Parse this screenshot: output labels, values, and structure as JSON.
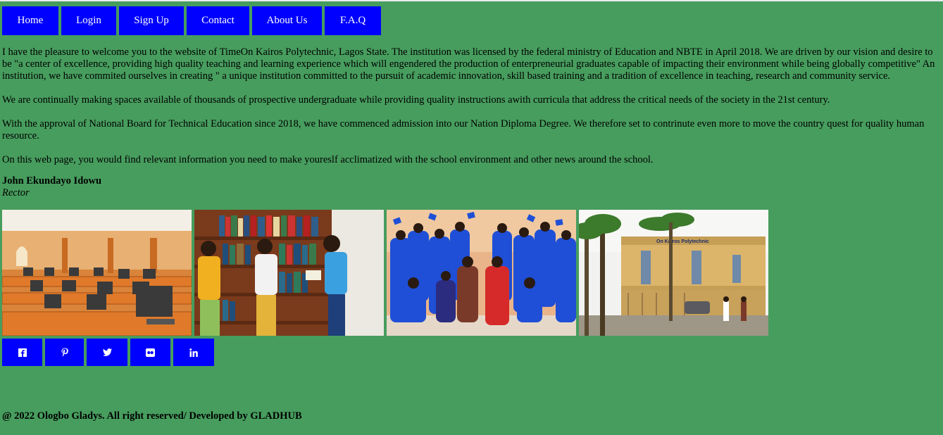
{
  "nav": {
    "items": [
      {
        "label": "Home"
      },
      {
        "label": "Login"
      },
      {
        "label": "Sign Up"
      },
      {
        "label": "Contact"
      },
      {
        "label": "About Us"
      },
      {
        "label": "F.A.Q"
      }
    ]
  },
  "content": {
    "paragraphs": [
      "I have the pleasure to welcome you to the website of TimeOn Kairos Polytechnic, Lagos State. The institution was licensed by the federal ministry of Education and NBTE in April 2018. We are driven by our vision and desire to be \"a center of excellence, providing high quality teaching and learning experience which will engendered the production of enterpreneurial graduates capable of impacting their environment while being globally competitive\" An institution, we have commited ourselves in creating \" a unique institution committed to the pursuit of academic innovation, skill based training and a tradition of excellence in teaching, research and community service.",
      "We are continually making spaces available of thousands of prospective undergraduate while providing quality instructions awith curricula that address the critical needs of the society in the 21st century.",
      "With the approval of National Board for Technical Education since 2018, we have commenced admission into our Nation Diploma Degree. We therefore set to contrinute even more to move the country quest for quality human resource.",
      "On this web page, you would find relevant information you need to make youreslf acclimatized with the school environment and other news around the school."
    ],
    "signature_name": "John Ekundayo Idowu",
    "signature_role": "Rector"
  },
  "gallery": {
    "photos": [
      {
        "name": "computer-lab-photo"
      },
      {
        "name": "library-photo"
      },
      {
        "name": "graduation-photo"
      },
      {
        "name": "campus-building-photo"
      }
    ],
    "building_sign": "On Kairos Polytechnic"
  },
  "social": {
    "icons": [
      "facebook-icon",
      "pinterest-icon",
      "twitter-icon",
      "flickr-icon",
      "linkedin-icon"
    ]
  },
  "footer": {
    "text": "@ 2022 Ologbo Gladys. All right reserved/ Developed by GLADHUB"
  },
  "colors": {
    "background": "#479d5e",
    "button": "#0000ff",
    "button_text": "#ffffff"
  }
}
